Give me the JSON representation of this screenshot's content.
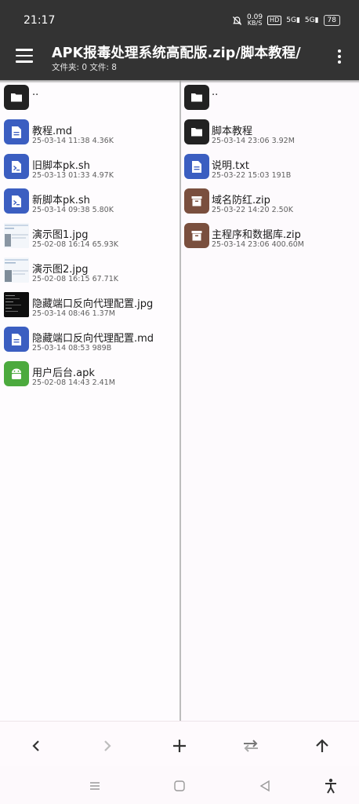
{
  "status_bar": {
    "time": "21:17",
    "net_speed_value": "0.09",
    "net_speed_unit": "KB/S",
    "hd_label": "HD",
    "signal1": "5G",
    "signal2": "5G",
    "battery": "78"
  },
  "header": {
    "title": "APK报毒处理系统高配版.zip/脚本教程/",
    "subtitle": "文件夹: 0  文件: 8"
  },
  "left_pane": {
    "up_label": "..",
    "items": [
      {
        "name": "教程.md",
        "date": "25-03-14 11:38",
        "size": "4.36K",
        "icon": "document-icon"
      },
      {
        "name": "旧脚本pk.sh",
        "date": "25-03-13 01:33",
        "size": "4.97K",
        "icon": "terminal-icon"
      },
      {
        "name": "新脚本pk.sh",
        "date": "25-03-14 09:38",
        "size": "5.80K",
        "icon": "terminal-icon"
      },
      {
        "name": "演示图1.jpg",
        "date": "25-02-08 16:14",
        "size": "65.93K",
        "icon": "image-thumbnail"
      },
      {
        "name": "演示图2.jpg",
        "date": "25-02-08 16:15",
        "size": "67.71K",
        "icon": "image-thumbnail"
      },
      {
        "name": "隐藏端口反向代理配置.jpg",
        "date": "25-03-14 08:46",
        "size": "1.37M",
        "icon": "image-thumbnail"
      },
      {
        "name": "隐藏端口反向代理配置.md",
        "date": "25-03-14 08:53",
        "size": "989B",
        "icon": "document-icon"
      },
      {
        "name": "用户后台.apk",
        "date": "25-02-08 14:43",
        "size": "2.41M",
        "icon": "android-icon"
      }
    ]
  },
  "right_pane": {
    "up_label": "..",
    "items": [
      {
        "name": "脚本教程",
        "date": "25-03-14 23:06",
        "size": "3.92M",
        "icon": "folder-icon"
      },
      {
        "name": "说明.txt",
        "date": "25-03-22 15:03",
        "size": "191B",
        "icon": "document-icon"
      },
      {
        "name": "域名防红.zip",
        "date": "25-03-22 14:20",
        "size": "2.50K",
        "icon": "archive-icon"
      },
      {
        "name": "主程序和数据库.zip",
        "date": "25-03-14 23:06",
        "size": "400.60M",
        "icon": "archive-icon"
      }
    ]
  },
  "colors": {
    "header_bg": "#333333",
    "folder_icon_bg": "#222222",
    "document_icon_bg": "#3b5ec1",
    "archive_icon_bg": "#7a4f3e",
    "apk_icon_bg": "#4caa3e",
    "page_bg": "#fdfafd"
  },
  "bottom_toolbar": {
    "buttons": [
      "back-icon",
      "forward-icon",
      "add-icon",
      "swap-icon",
      "up-icon"
    ]
  },
  "nav_bar": {
    "buttons": [
      "recents-icon",
      "home-icon",
      "back-triangle-icon",
      "accessibility-icon"
    ]
  }
}
